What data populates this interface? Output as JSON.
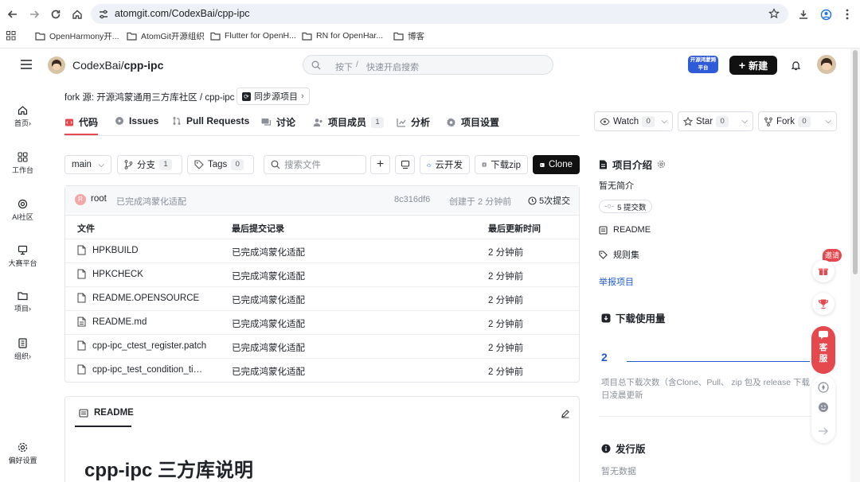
{
  "browser": {
    "url": "atomgit.com/CodexBai/cpp-ipc",
    "bookmarks": [
      {
        "label": "OpenHarmony开..."
      },
      {
        "label": "AtomGit开源组织"
      },
      {
        "label": "Flutter for OpenH..."
      },
      {
        "label": "RN for OpenHar..."
      },
      {
        "label": "博客"
      }
    ]
  },
  "header": {
    "owner": "CodexBai",
    "separator": "/",
    "repo": "cpp-ipc",
    "search_hint": "按下",
    "search_key": "/",
    "search_placeholder": "快速开启搜索",
    "new_label": "新建",
    "badge_text": "开源鸿蒙跨平台"
  },
  "leftnav": [
    {
      "label": "首页",
      "chevron": "›",
      "icon": "home-icon"
    },
    {
      "label": "工作台",
      "chevron": "",
      "icon": "grid-icon"
    },
    {
      "label": "AI社区",
      "chevron": "",
      "icon": "ai-icon"
    },
    {
      "label": "大赛平台",
      "chevron": "",
      "icon": "trophy-icon"
    },
    {
      "label": "项目",
      "chevron": "›",
      "icon": "folder-icon"
    },
    {
      "label": "组织",
      "chevron": "›",
      "icon": "org-icon"
    },
    {
      "label": "偏好设置",
      "chevron": "",
      "icon": "settings-icon"
    }
  ],
  "fork": {
    "prefix": "fork 源:",
    "source": "开源鸿蒙通用三方库社区 / cpp-ipc",
    "sync_label": "同步源项目"
  },
  "tabs": [
    {
      "label": "代码",
      "count": null
    },
    {
      "label": "Issues",
      "count": null
    },
    {
      "label": "Pull Requests",
      "count": null
    },
    {
      "label": "讨论",
      "count": null
    },
    {
      "label": "项目成员",
      "count": "1"
    },
    {
      "label": "分析",
      "count": null
    },
    {
      "label": "项目设置",
      "count": null
    }
  ],
  "actions": {
    "watch_label": "Watch",
    "watch_count": "0",
    "star_label": "Star",
    "star_count": "0",
    "fork_label": "Fork",
    "fork_count": "0"
  },
  "toolbar": {
    "branch": "main",
    "branches_label": "分支",
    "branches_count": "1",
    "tags_label": "Tags",
    "tags_count": "0",
    "search_placeholder": "搜索文件",
    "cloud_label": "云开发",
    "download_label": "下载zip",
    "clone_label": "Clone"
  },
  "commit": {
    "avatar_letter": "R",
    "author": "root",
    "message": "已完成鸿蒙化适配",
    "hash": "8c316df6",
    "time": "创建于 2 分钟前",
    "count_label": "5次提交"
  },
  "table": {
    "headers": [
      "文件",
      "最后提交记录",
      "最后更新时间"
    ],
    "rows": [
      {
        "name": "HPKBUILD",
        "message": "已完成鸿蒙化适配",
        "time": "2 分钟前",
        "icon": "file-icon"
      },
      {
        "name": "HPKCHECK",
        "message": "已完成鸿蒙化适配",
        "time": "2 分钟前",
        "icon": "file-icon"
      },
      {
        "name": "README.OPENSOURCE",
        "message": "已完成鸿蒙化适配",
        "time": "2 分钟前",
        "icon": "file-icon"
      },
      {
        "name": "README.md",
        "message": "已完成鸿蒙化适配",
        "time": "2 分钟前",
        "icon": "file-text-icon"
      },
      {
        "name": "cpp-ipc_ctest_register.patch",
        "message": "已完成鸿蒙化适配",
        "time": "2 分钟前",
        "icon": "file-icon"
      },
      {
        "name": "cpp-ipc_test_condition_ti…",
        "message": "已完成鸿蒙化适配",
        "time": "2 分钟前",
        "icon": "file-icon"
      }
    ]
  },
  "readme": {
    "tab_label": "README",
    "heading": "cpp-ipc 三方库说明"
  },
  "sidebar": {
    "intro_title": "项目介绍",
    "intro_text": "暂无简介",
    "commits_badge": "5 提交数",
    "readme_link": "README",
    "rules_link": "规则集",
    "report_link": "举报项目",
    "downloads_title": "下载使用量",
    "downloads_value": "2",
    "downloads_desc_line1": "项目总下载次数（含Clone、Pull、 zip 包及 release 下载",
    "downloads_desc_line2": "日凌晨更新",
    "release_title": "发行版",
    "release_text": "暂无数据"
  },
  "floating": {
    "invite_label": "邀请",
    "service_label": "客服"
  },
  "colors": {
    "accent": "#1d5ad7",
    "danger": "#e5484d",
    "clone_bg": "#111111",
    "muted": "#8a8f99"
  }
}
